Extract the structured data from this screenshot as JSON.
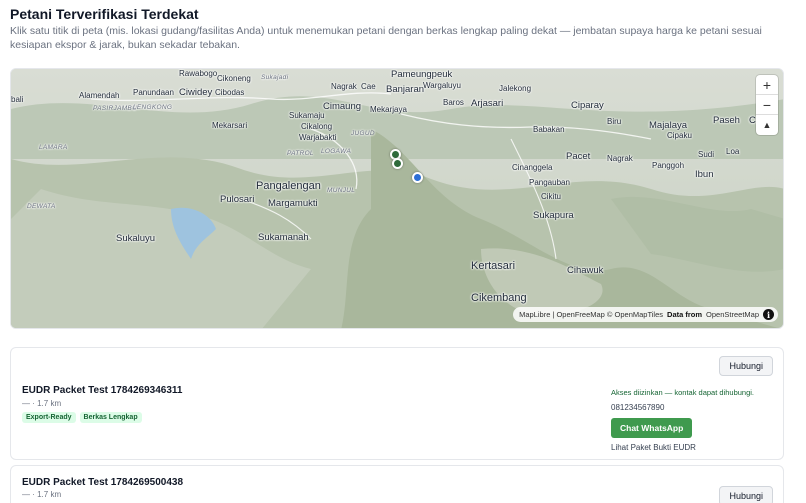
{
  "header": {
    "title": "Petani Terverifikasi Terdekat",
    "description": "Klik satu titik di peta (mis. lokasi gudang/fasilitas Anda) untuk menemukan petani dengan berkas lengkap paling dekat — jembatan supaya harga ke petani sesuai kesiapan ekspor & jarak, bukan sekadar tebakan."
  },
  "map": {
    "places": {
      "rawabogo": "Rawabogo",
      "cikoneng": "Cikoneng",
      "sukajadi": "Sukajadi",
      "bali": "bali",
      "alamendah": "Alamendah",
      "panundaan": "Panundaan",
      "ciwidey": "Ciwidey",
      "cibodas": "Cibodas",
      "pasirjambu": "PASIRJAMBU",
      "lengkong": "LENGKONG",
      "nagrak_north": "Nagrak",
      "cae": "Cae",
      "pameungpeuk": "Pameungpeuk",
      "banjaran": "Banjaran",
      "wargaluyu": "Wargaluyu",
      "jalekong": "Jalekong",
      "cimaung": "Cimaung",
      "mekarjaya": "Mekarjaya",
      "baros": "Baros",
      "arjasari": "Arjasari",
      "ciparay": "Ciparay",
      "sukamaju": "Sukamaju",
      "mekarsari": "Mekarsari",
      "cikalong": "Cikalong",
      "warjabakti": "Warjabakti",
      "jugud": "JUGUD",
      "biru": "Biru",
      "majalaya": "Majalaya",
      "paseh": "Paseh",
      "cil": "Cil",
      "babakan": "Babakan",
      "cipaku": "Cipaku",
      "lamara": "LAMARA",
      "patrol": "PATROL",
      "logawa": "LOGAWA",
      "pacet": "Pacet",
      "nagrak_south": "Nagrak",
      "sudi": "Sudi",
      "loa": "Loa",
      "cinanggela": "Cinanggela",
      "panggoh": "Panggoh",
      "ibun": "Ibun",
      "pangalengan": "Pangalengan",
      "munjul": "MUNJUL",
      "pangauban": "Pangauban",
      "pulosari": "Pulosari",
      "cikitu": "Cikitu",
      "margamukti": "Margamukti",
      "dewata": "DEWATA",
      "sukapura": "Sukapura",
      "sukaluyu": "Sukaluyu",
      "sukamanah": "Sukamanah",
      "kertasari": "Kertasari",
      "cihawuk": "Cihawuk",
      "cikembang": "Cikembang"
    },
    "zoom_in_label": "+",
    "zoom_out_label": "−",
    "compass_label": "▲",
    "attribution": {
      "text": "MapLibre | OpenFreeMap © OpenMapTiles",
      "bold": "Data from",
      "tail": "OpenStreetMap"
    },
    "info_icon_label": "i"
  },
  "farmers": [
    {
      "name": "EUDR Packet Test 1784269346311",
      "distance": "— · 1.7 km",
      "badges": [
        "Export-Ready",
        "Berkas Lengkap"
      ],
      "contact_button": "Hubungi",
      "access_note": "Akses diizinkan — kontak dapat dihubungi.",
      "phone": "081234567890",
      "whatsapp_button": "Chat WhatsApp",
      "eudr_link": "Lihat Paket Bukti EUDR"
    },
    {
      "name": "EUDR Packet Test 1784269500438",
      "distance": "— · 1.7 km",
      "contact_button": "Hubungi"
    }
  ]
}
